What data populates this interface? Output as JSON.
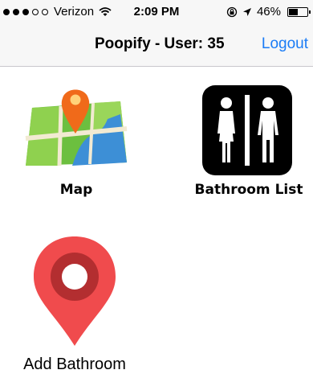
{
  "status_bar": {
    "signal_bars_filled": 3,
    "signal_bars_total": 5,
    "carrier": "Verizon",
    "time": "2:09 PM",
    "battery": "46%",
    "icons": [
      "wifi-icon",
      "rotation-lock-icon",
      "location-arrow-icon",
      "battery-icon"
    ]
  },
  "nav": {
    "title": "Poopify - User: 35",
    "logout_label": "Logout",
    "accent_color": "#1b7cf6"
  },
  "tiles": {
    "map_label": "Map",
    "bathroom_list_label": "Bathroom List",
    "add_bathroom_label": "Add Bathroom"
  },
  "colors": {
    "pin_red": "#f04b4d",
    "pin_dark": "#b32e30"
  }
}
